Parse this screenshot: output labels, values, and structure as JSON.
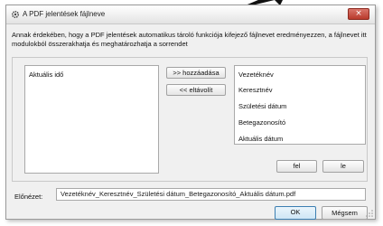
{
  "dialog": {
    "title": "A PDF jelentések fájlneve",
    "close_label": "×",
    "description": "Annak érdekében, hogy a PDF jelentések automatikus tároló funkciója kifejező fájlnevet eredményezzen, a fájlnevet itt modulokból összerakhatja és meghatározhatja a sorrendet"
  },
  "available_modules": {
    "items": [
      "Aktuális idő"
    ]
  },
  "buttons": {
    "add": ">> hozzáadása",
    "remove": "<< eltávolít",
    "up": "fel",
    "down": "le",
    "ok": "OK",
    "cancel": "Mégsem"
  },
  "selected_modules": {
    "items": [
      "Vezetéknév",
      "Keresztnév",
      "Születési dátum",
      "Betegazonosító",
      "Aktuális dátum"
    ]
  },
  "preview": {
    "label": "Előnézet:",
    "value": "Vezetéknév_Keresztnév_Születési dátum_Betegazonosító_Aktuális dátum.pdf"
  },
  "icons": {
    "title": "gear-icon",
    "close": "close-icon",
    "resize": "resize-grip-icon"
  },
  "colors": {
    "close_button": "#c0392b",
    "ok_button_border": "#3c7fb1",
    "dialog_background": "#f0f0f0"
  }
}
